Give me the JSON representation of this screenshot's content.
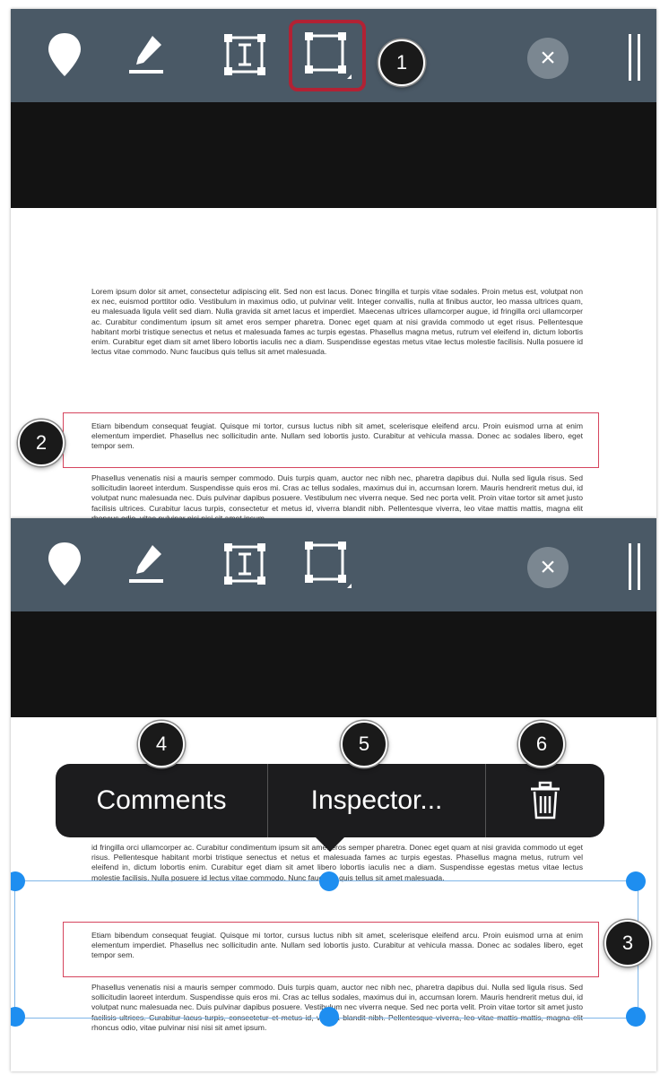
{
  "toolbar": {
    "tools": [
      "pin-tool",
      "highlight-tool",
      "text-select-tool",
      "box-tool"
    ],
    "close_glyph": "×",
    "accent": "#b22234"
  },
  "callouts": [
    "1",
    "2",
    "3",
    "4",
    "5",
    "6"
  ],
  "document": {
    "paragraph1": "Lorem ipsum dolor sit amet, consectetur adipiscing elit. Sed non est lacus. Donec fringilla et turpis vitae sodales. Proin metus est, volutpat non ex nec, euismod porttitor odio. Vestibulum in maximus odio, ut pulvinar velit. Integer convallis, nulla at finibus auctor, leo massa ultrices quam, eu malesuada ligula velit sed diam. Nulla gravida sit amet lacus et imperdiet. Maecenas ultrices ullamcorper augue, id fringilla orci ullamcorper ac. Curabitur condimentum ipsum sit amet eros semper pharetra. Donec eget quam at nisi gravida commodo ut eget risus. Pellentesque habitant morbi tristique senectus et netus et malesuada fames ac turpis egestas. Phasellus magna metus, rutrum vel eleifend in, dictum lobortis enim. Curabitur eget diam sit amet libero lobortis iaculis nec a diam. Suspendisse egestas metus vitae lectus molestie facilisis. Nulla posuere id lectus vitae commodo. Nunc faucibus quis tellus sit amet malesuada.",
    "paragraph2": "Etiam bibendum consequat feugiat. Quisque mi tortor, cursus luctus nibh sit amet, scelerisque eleifend arcu. Proin euismod urna at enim elementum imperdiet. Phasellus nec sollicitudin ante. Nullam sed lobortis justo. Curabitur at vehicula massa. Donec ac sodales libero, eget tempor sem.",
    "paragraph3": "Phasellus venenatis nisi a mauris semper commodo. Duis turpis quam, auctor nec nibh nec, pharetra dapibus dui. Nulla sed ligula risus. Sed sollicitudin laoreet interdum. Suspendisse quis eros mi. Cras ac tellus sodales, maximus dui in, accumsan lorem. Mauris hendrerit metus dui, id volutpat nunc malesuada nec. Duis pulvinar dapibus posuere. Vestibulum nec viverra neque. Sed nec porta velit. Proin vitae tortor sit amet justo facilisis ultrices. Curabitur lacus turpis, consectetur et metus id, viverra blandit nibh. Pellentesque viverra, leo vitae mattis mattis, magna elit rhoncus odio, vitae pulvinar nisi nisi sit amet ipsum.",
    "paragraph1_tail": "id fringilla orci ullamcorper ac. Curabitur condimentum ipsum sit amet eros semper pharetra. Donec eget quam at nisi gravida commodo ut eget risus. Pellentesque habitant morbi tristique senectus et netus et malesuada fames ac turpis egestas. Phasellus magna metus, rutrum vel eleifend in, dictum lobortis enim. Curabitur eget diam sit amet libero lobortis iaculis nec a diam. Suspendisse egestas metus vitae lectus molestie facilisis. Nulla posuere id lectus vitae commodo. Nunc faucibus quis tellus sit amet malesuada."
  },
  "context_menu": {
    "comments": "Comments",
    "inspector": "Inspector...",
    "delete_icon": "trash-icon"
  },
  "colors": {
    "toolbar": "#4a5966",
    "selection": "#1e8ef0",
    "highlight_border": "#d6455e"
  }
}
